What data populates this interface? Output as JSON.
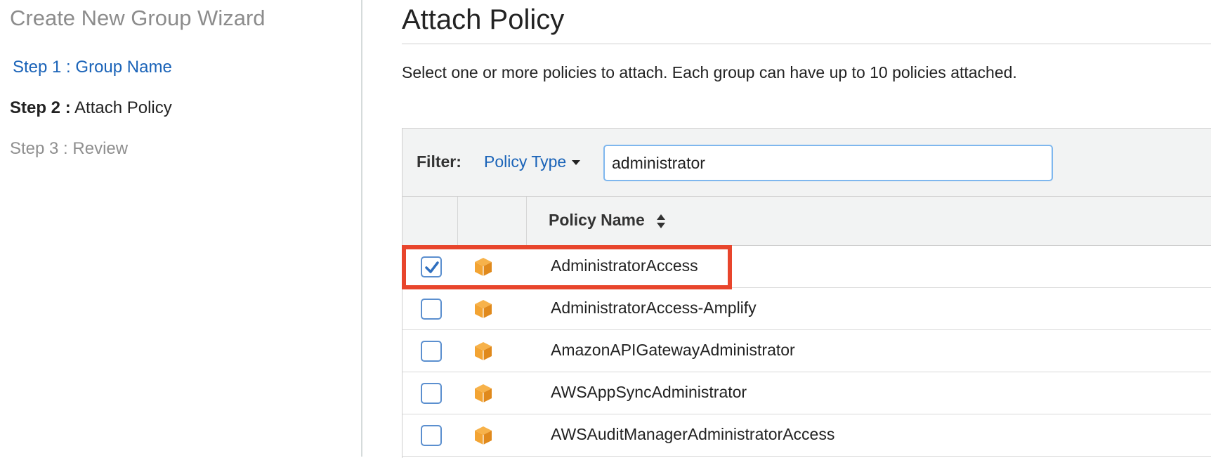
{
  "sidebar": {
    "title": "Create New Group Wizard",
    "steps": [
      {
        "prefix": "Step 1 :",
        "label": "Group Name",
        "state": "link"
      },
      {
        "prefix": "Step 2 :",
        "label": "Attach Policy",
        "state": "current"
      },
      {
        "prefix": "Step 3 :",
        "label": "Review",
        "state": "disabled"
      }
    ]
  },
  "main": {
    "title": "Attach Policy",
    "description": "Select one or more policies to attach. Each group can have up to 10 policies attached.",
    "filter": {
      "label": "Filter:",
      "policy_type_label": "Policy Type",
      "search_value": "administrator"
    },
    "table": {
      "column_policy_name": "Policy Name",
      "rows": [
        {
          "name": "AdministratorAccess",
          "checked": true,
          "icon": "aws-managed-policy-icon"
        },
        {
          "name": "AdministratorAccess-Amplify",
          "checked": false,
          "icon": "aws-managed-policy-icon"
        },
        {
          "name": "AmazonAPIGatewayAdministrator",
          "checked": false,
          "icon": "aws-managed-policy-icon"
        },
        {
          "name": "AWSAppSyncAdministrator",
          "checked": false,
          "icon": "aws-managed-policy-icon"
        },
        {
          "name": "AWSAuditManagerAdministratorAccess",
          "checked": false,
          "icon": "aws-managed-policy-icon"
        }
      ]
    }
  },
  "colors": {
    "link": "#1a63b8",
    "highlight": "#e8452c",
    "policy_icon": "#f3a433",
    "checkbox": "#5b8fcf"
  }
}
